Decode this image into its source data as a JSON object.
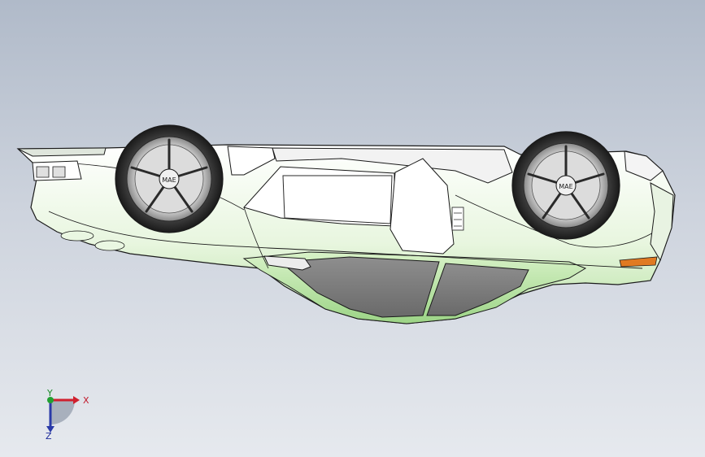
{
  "viewport": {
    "background_top": "#b0bac9",
    "background_bottom": "#e6e9ee",
    "model_face_color": "#ffffff",
    "model_highlight_color": "#d6f0c8",
    "edge_color": "#1a1a1a",
    "wheel_hub_label": "MAE"
  },
  "triad": {
    "x_label": "X",
    "y_label": "Y",
    "z_label": "Z",
    "x_color": "#d0202e",
    "y_color": "#22a032",
    "z_color": "#2a3aa8"
  }
}
